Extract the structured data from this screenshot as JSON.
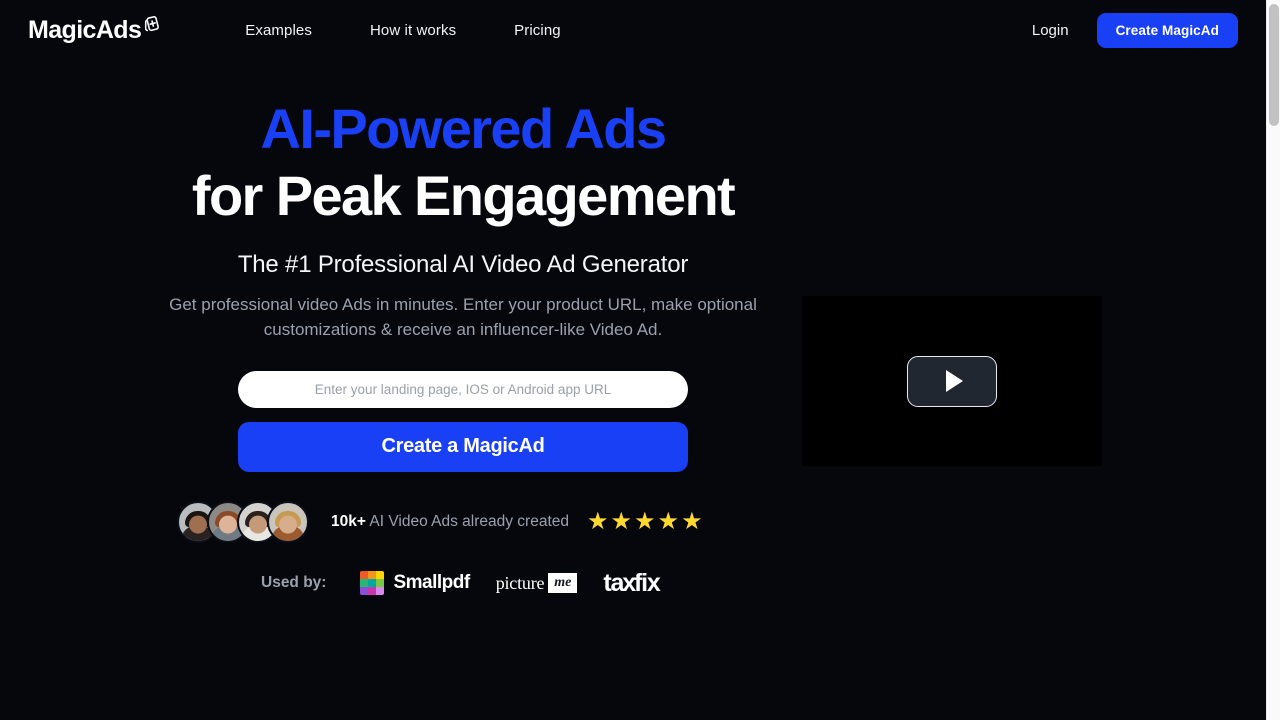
{
  "brand": {
    "name": "MagicAds",
    "logo_icon": "card-plus-icon"
  },
  "theme": {
    "background": "#05070d",
    "accent_blue": "#1a40f5",
    "text_primary": "#ffffff",
    "text_muted": "#9ba1ac",
    "star_yellow": "#ffd92e"
  },
  "header": {
    "nav": [
      {
        "label": "Examples",
        "name": "nav-examples"
      },
      {
        "label": "How it works",
        "name": "nav-how-it-works"
      },
      {
        "label": "Pricing",
        "name": "nav-pricing"
      }
    ],
    "login_label": "Login",
    "cta_label": "Create MagicAd"
  },
  "hero": {
    "headline_line1": "AI-Powered Ads",
    "headline_line2": "for Peak Engagement",
    "subtitle": "The #1 Professional AI Video Ad Generator",
    "description": "Get professional video Ads in minutes. Enter your product URL, make optional customizations & receive an influencer-like Video Ad.",
    "input_placeholder": "Enter your landing page, IOS or Android app URL",
    "input_value": "",
    "cta_label": "Create a MagicAd"
  },
  "social_proof": {
    "count": "10k+",
    "text": " AI Video Ads already created",
    "stars": 5,
    "avatars": [
      {
        "name": "avatar-1",
        "hair": "#1a1412",
        "skin": "#9e6f50",
        "bg": "#b9bcbe",
        "body": "#2a2220"
      },
      {
        "name": "avatar-2",
        "hair": "#8a4a26",
        "skin": "#ddb49a",
        "bg": "#8d8a86",
        "body": "#6f7a82"
      },
      {
        "name": "avatar-3",
        "hair": "#2b211c",
        "skin": "#c49a79",
        "bg": "#d4d3cf",
        "body": "#e8e6e1"
      },
      {
        "name": "avatar-4",
        "hair": "#c79a52",
        "skin": "#d8ad8b",
        "bg": "#c9c5bd",
        "body": "#9c5a2f"
      }
    ]
  },
  "used_by": {
    "label": "Used by:",
    "brands": [
      {
        "name": "smallpdf",
        "label": "Smallpdf"
      },
      {
        "name": "pictureme",
        "label": "picture",
        "badge": "me"
      },
      {
        "name": "taxfix",
        "label_a": "ta",
        "label_x": "x",
        "label_b": "fix"
      }
    ],
    "smallpdf_colors": [
      "#f05a28",
      "#f7941e",
      "#ffd400",
      "#2bb673",
      "#00a99d",
      "#7ac943",
      "#8a4fd8",
      "#c837ab",
      "#d988f2"
    ]
  },
  "video": {
    "play_icon": "play-icon"
  },
  "scrollbar": {
    "thumb_icon": "scrollbar-thumb"
  }
}
